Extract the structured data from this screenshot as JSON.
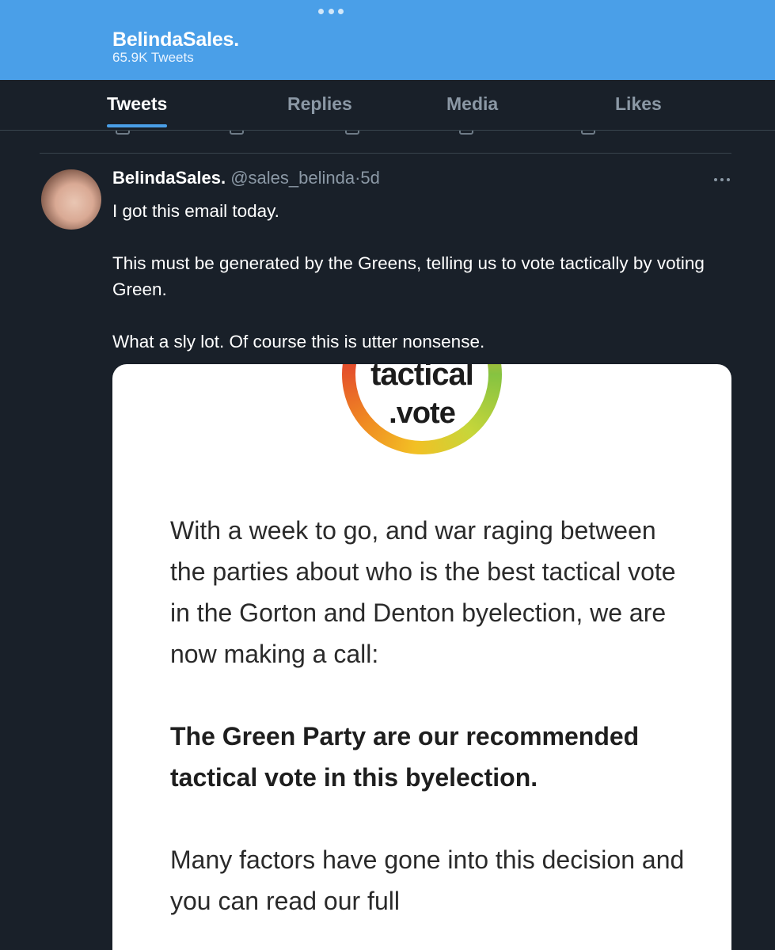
{
  "header": {
    "title": "BelindaSales.",
    "tweet_count": "65.9K Tweets",
    "accent_color": "#4a9fe8"
  },
  "tabs": [
    {
      "label": "Tweets",
      "active": true
    },
    {
      "label": "Replies",
      "active": false
    },
    {
      "label": "Media",
      "active": false
    },
    {
      "label": "Likes",
      "active": false
    }
  ],
  "tweet": {
    "display_name": "BelindaSales.",
    "handle": "@sales_belinda",
    "separator": "·",
    "time": "5d",
    "more_icon": "more-horizontal-icon",
    "paragraphs": [
      "I got this email today.",
      "This must be generated by the Greens, telling us to vote tactically by voting Green.",
      "What a sly lot. Of course this is utter nonsense."
    ]
  },
  "media": {
    "logo_top_word": "tactical",
    "logo_bottom_word": ".vote",
    "paragraphs": [
      "With a week to go, and war raging between the parties about who is the best tactical vote in the Gorton and Denton byelection, we are now making a call:",
      "The Green Party are our recommended tactical vote in this byelection.",
      "Many factors have gone into this decision and you can read our full"
    ]
  }
}
